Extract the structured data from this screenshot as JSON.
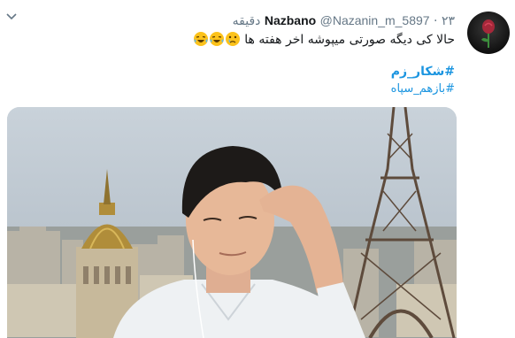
{
  "tweet": {
    "display_name": "Nazbano",
    "handle": "@Nazanin_m_5897",
    "separator": "·",
    "timestamp": "۲۳ دقیقه",
    "text": "حالا کی دیگه صورتی میپوشه اخر هفته ها",
    "emojis": [
      "crying-face-icon",
      "laughing-tears-icon",
      "laughing-tears-icon"
    ],
    "hashtags": [
      "#شکار_زم",
      "#بازهم_سپاه"
    ],
    "media_alt": "photo",
    "colors": {
      "text": "#14171a",
      "muted": "#657786",
      "link": "#1b95e0",
      "emoji": "#fcc21b"
    }
  }
}
